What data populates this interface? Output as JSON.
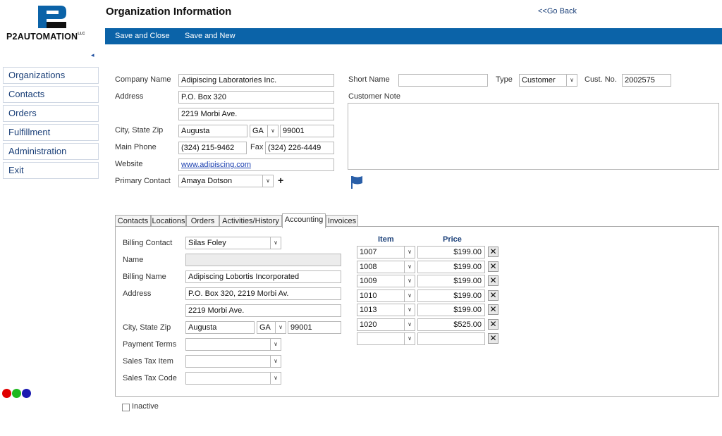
{
  "brand": {
    "logo_text": "P2AUTOMATION",
    "logo_sup": "LLC",
    "colors": {
      "accent": "#0b63a8",
      "nav_text": "#1a3f78",
      "logo_dark": "#111111",
      "logo_blue": "#0b63a8"
    }
  },
  "sidebar": {
    "collapse_icon": "◂",
    "items": [
      {
        "label": "Organizations"
      },
      {
        "label": "Contacts"
      },
      {
        "label": "Orders"
      },
      {
        "label": "Fulfillment"
      },
      {
        "label": "Administration"
      },
      {
        "label": "Exit"
      }
    ]
  },
  "status_dots": [
    "#e00000",
    "#1fb81f",
    "#1a1ab0"
  ],
  "header": {
    "title": "Organization Information",
    "go_back": "<<Go Back"
  },
  "toolbar": {
    "save_close": "Save and Close",
    "save_new": "Save and New"
  },
  "org": {
    "labels": {
      "company_name": "Company Name",
      "address": "Address",
      "city_state_zip": "City, State Zip",
      "main_phone": "Main Phone",
      "fax": "Fax",
      "website": "Website",
      "primary_contact": "Primary Contact",
      "short_name": "Short Name",
      "type": "Type",
      "cust_no": "Cust. No.",
      "customer_note": "Customer Note"
    },
    "company_name": "Adipiscing Laboratories Inc.",
    "address1": "P.O. Box 320",
    "address2": "2219 Morbi Ave.",
    "city": "Augusta",
    "state": "GA",
    "zip": "99001",
    "main_phone": "(324) 215-9462",
    "fax": "(324) 226-4449",
    "website": "www.adipiscing.com",
    "primary_contact": "Amaya Dotson",
    "add_contact_icon": "+",
    "short_name": "",
    "type": "Customer",
    "cust_no": "2002575",
    "customer_note": ""
  },
  "tabs": [
    {
      "label": "Contacts"
    },
    {
      "label": "Locations"
    },
    {
      "label": "Orders"
    },
    {
      "label": "Activities/History"
    },
    {
      "label": "Accounting"
    },
    {
      "label": "Invoices"
    }
  ],
  "accounting": {
    "labels": {
      "billing_contact": "Billing Contact",
      "name": "Name",
      "billing_name": "Billing Name",
      "address": "Address",
      "city_state_zip": "City, State Zip",
      "payment_terms": "Payment Terms",
      "sales_tax_item": "Sales Tax Item",
      "sales_tax_code": "Sales Tax Code"
    },
    "billing_contact": "Silas Foley",
    "name": "",
    "billing_name": "Adipiscing Lobortis Incorporated",
    "address1": "P.O. Box 320, 2219 Morbi Av.",
    "address2": "2219 Morbi Ave.",
    "city": "Augusta",
    "state": "GA",
    "zip": "99001",
    "payment_terms": "",
    "sales_tax_item": "",
    "sales_tax_code": "",
    "items_header": {
      "item": "Item",
      "price": "Price"
    },
    "items": [
      {
        "item": "1007",
        "price": "$199.00"
      },
      {
        "item": "1008",
        "price": "$199.00"
      },
      {
        "item": "1009",
        "price": "$199.00"
      },
      {
        "item": "1010",
        "price": "$199.00"
      },
      {
        "item": "1013",
        "price": "$199.00"
      },
      {
        "item": "1020",
        "price": "$525.00"
      },
      {
        "item": "",
        "price": ""
      }
    ],
    "delete_icon": "✕"
  },
  "inactive_label": "Inactive"
}
